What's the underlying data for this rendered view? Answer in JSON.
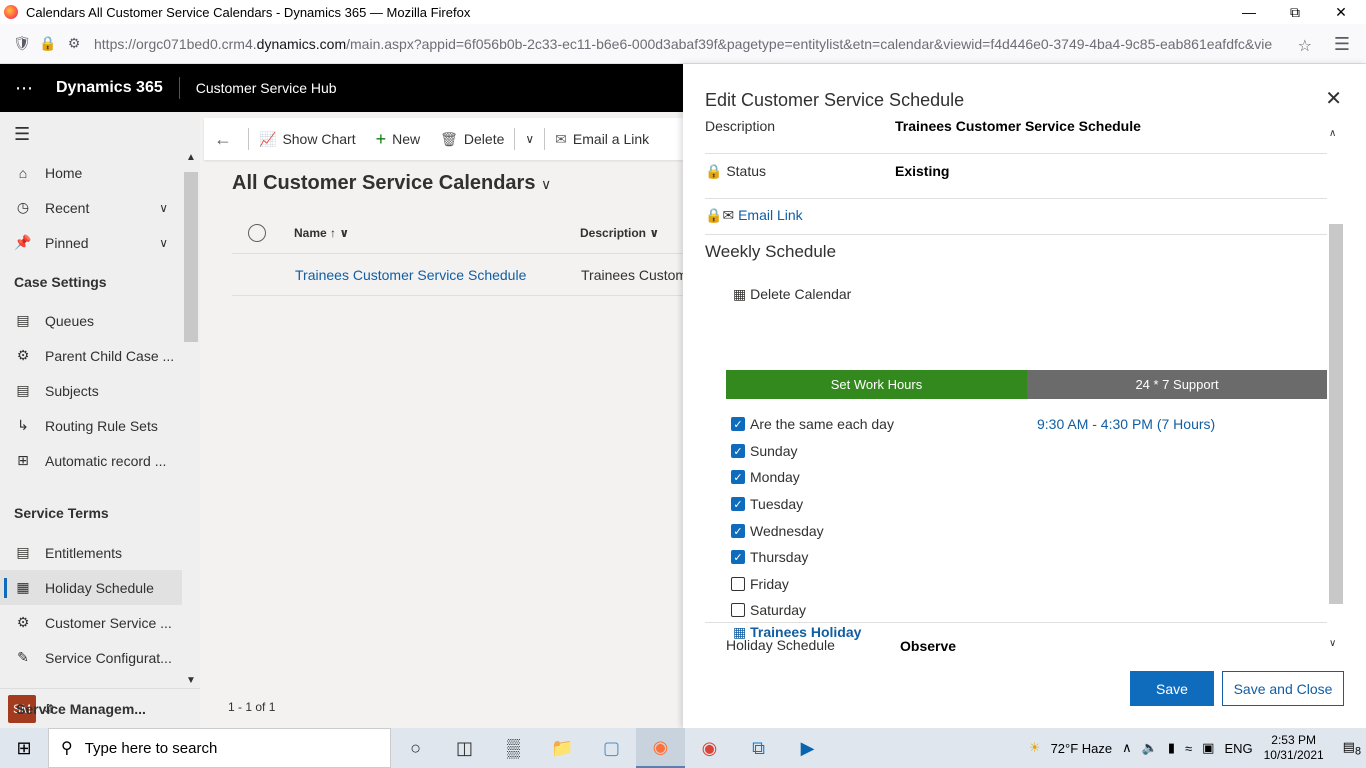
{
  "browser": {
    "window_title": "Calendars All Customer Service Calendars - Dynamics 365 — Mozilla Firefox",
    "url_prefix": "https://orgc071bed0.crm4.",
    "url_domain": "dynamics.com",
    "url_rest": "/main.aspx?appid=6f056b0b-2c33-ec11-b6e6-000d3abaf39f&pagetype=entitylist&etn=calendar&viewid=f4d446e0-3749-4ba4-9c85-eab861eafdfc&vie"
  },
  "app": {
    "brand": "Dynamics 365",
    "name": "Customer Service Hub"
  },
  "sidebar": {
    "top_items": [
      {
        "label": "Home"
      },
      {
        "label": "Recent"
      },
      {
        "label": "Pinned"
      }
    ],
    "section1": "Case Settings",
    "case_items": [
      {
        "label": "Queues"
      },
      {
        "label": "Parent Child Case ..."
      },
      {
        "label": "Subjects"
      },
      {
        "label": "Routing Rule Sets"
      },
      {
        "label": "Automatic record ..."
      }
    ],
    "section2": "Service Terms",
    "term_items": [
      {
        "label": "Entitlements"
      },
      {
        "label": "Holiday Schedule"
      },
      {
        "label": "Customer Service ..."
      },
      {
        "label": "Service Configurat..."
      }
    ],
    "area_badge": "SM",
    "area_label": "Service Managem..."
  },
  "commandbar": {
    "show_chart": "Show Chart",
    "new": "New",
    "delete": "Delete",
    "email_link": "Email a Link"
  },
  "view": {
    "title": "All Customer Service Calendars",
    "col_name": "Name",
    "col_desc": "Description",
    "rows": [
      {
        "name": "Trainees Customer Service Schedule",
        "description": "Trainees Customer Service Schedule"
      }
    ],
    "footer": "1 - 1 of 1"
  },
  "dialog": {
    "title": "Edit Customer Service Schedule",
    "description_label": "Description",
    "description_value": "Trainees Customer Service Schedule",
    "status_label": "Status",
    "status_value": "Existing",
    "email_link": "Email Link",
    "weekly_heading": "Weekly Schedule",
    "delete_calendar": "Delete Calendar",
    "tab_work_hours": "Set Work Hours",
    "tab_support": "24 * 7 Support",
    "same_each_day": "Are the same each day",
    "hours_link": "9:30 AM - 4:30 PM (7 Hours)",
    "days": [
      {
        "label": "Sunday",
        "checked": true
      },
      {
        "label": "Monday",
        "checked": true
      },
      {
        "label": "Tuesday",
        "checked": true
      },
      {
        "label": "Wednesday",
        "checked": true
      },
      {
        "label": "Thursday",
        "checked": true
      },
      {
        "label": "Friday",
        "checked": false
      },
      {
        "label": "Saturday",
        "checked": false
      }
    ],
    "holiday_label": "Holiday Schedule",
    "holiday_value": "Observe",
    "holiday_calendar": "Trainees Holiday",
    "save": "Save",
    "save_close": "Save and Close"
  },
  "taskbar": {
    "search_placeholder": "Type here to search",
    "weather": "72°F  Haze",
    "lang": "ENG",
    "time": "2:53 PM",
    "date": "10/31/2021",
    "notif_count": "8"
  },
  "colors": {
    "accent": "#0f6cbd",
    "work_hours_tab": "#34891e",
    "support_tab": "#6b6b6b"
  }
}
